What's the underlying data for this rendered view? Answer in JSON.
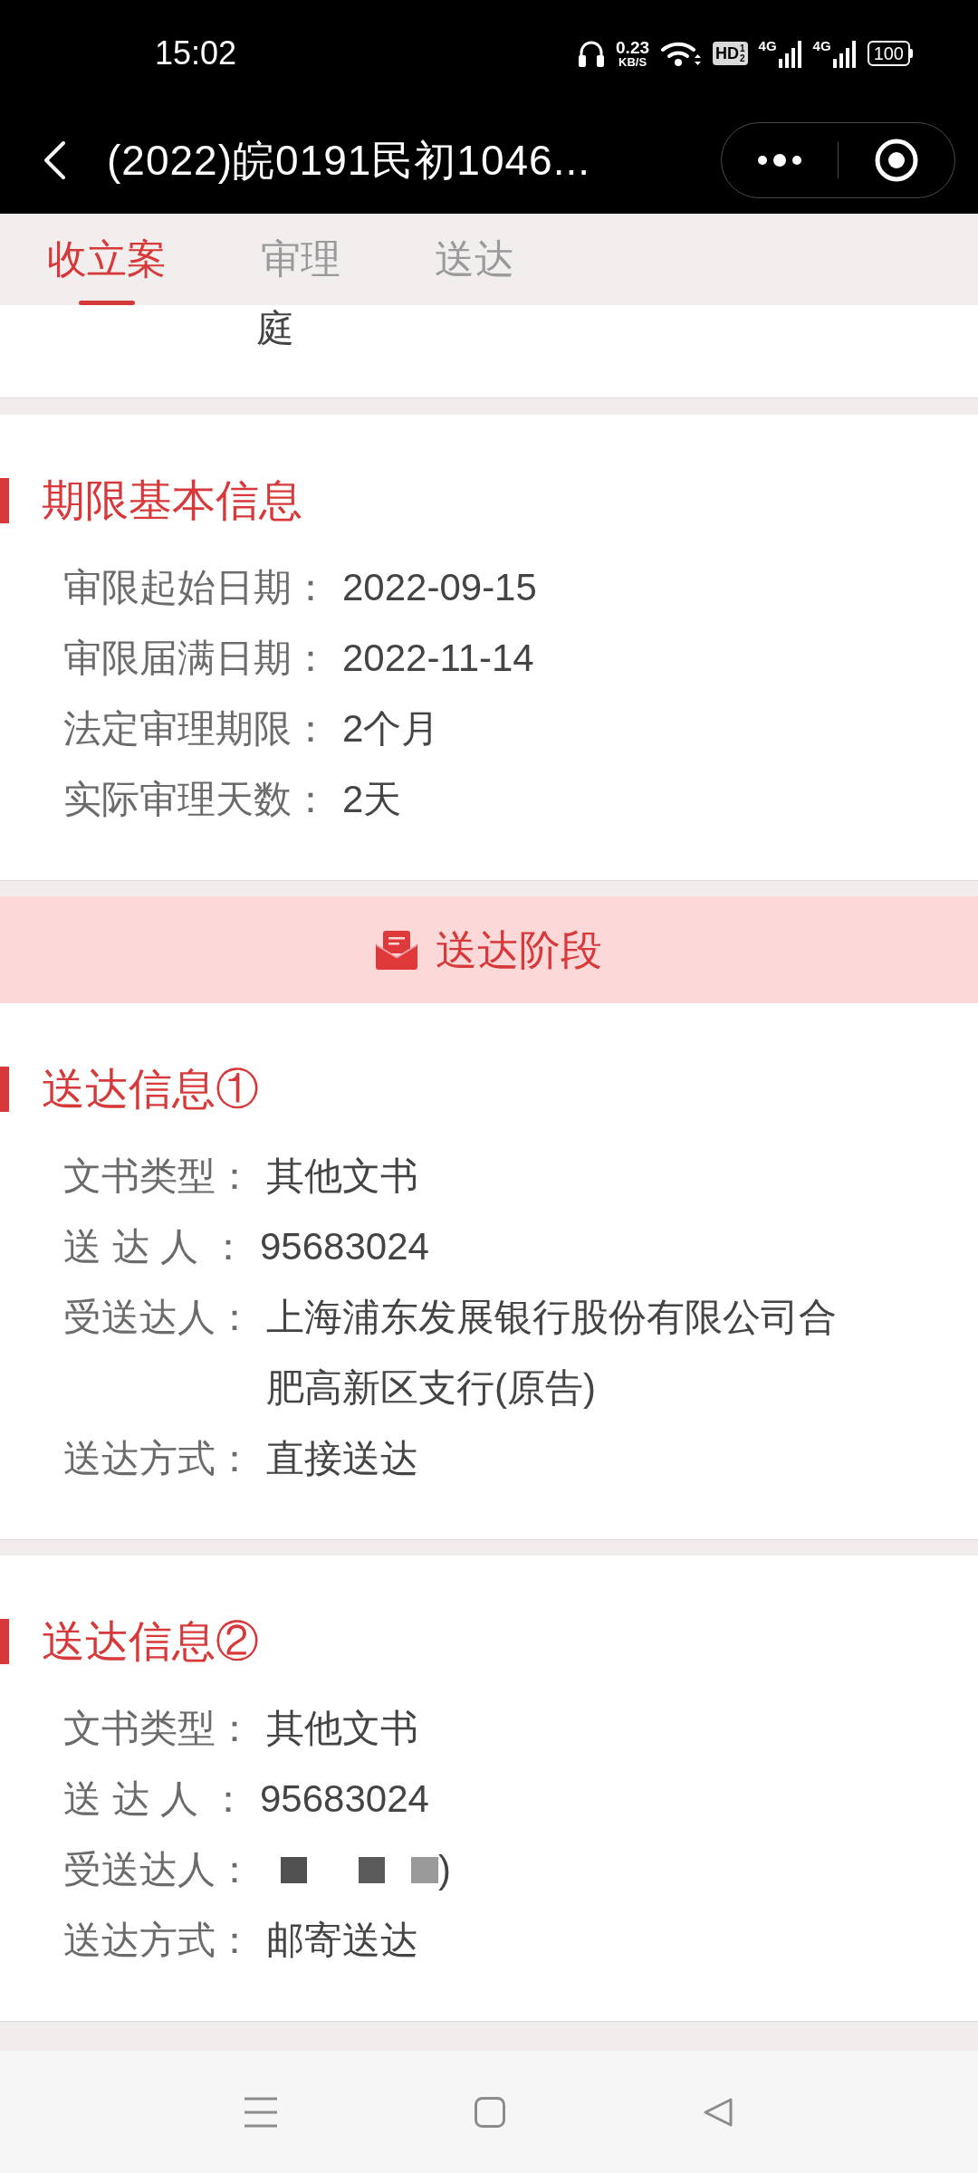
{
  "status_bar": {
    "time": "15:02",
    "net_speed": {
      "value": "0.23",
      "unit": "KB/S"
    },
    "hd_badge": {
      "label": "HD",
      "sup": "1",
      "sub": "2"
    },
    "signals": [
      {
        "network": "4G"
      },
      {
        "network": "4G"
      }
    ],
    "battery": "100"
  },
  "title_bar": {
    "title": "(2022)皖0191民初1046..."
  },
  "tabs": [
    {
      "label": "收立案",
      "selected": true
    },
    {
      "label": "审理",
      "selected": false
    },
    {
      "label": "送达",
      "selected": false
    }
  ],
  "previous_section": {
    "text": "庭"
  },
  "sections": [
    {
      "kind": "info",
      "title": "期限基本信息",
      "fields": [
        {
          "label": "审限起始日期：",
          "value": "2022-09-15",
          "redacted": false
        },
        {
          "label": "审限届满日期：",
          "value": "2022-11-14",
          "redacted": false
        },
        {
          "label": "法定审理期限：",
          "value": "2个月",
          "redacted": false
        },
        {
          "label": "实际审理天数：",
          "value": "2天",
          "redacted": false
        }
      ]
    },
    {
      "kind": "stage_banner",
      "title": "送达阶段"
    },
    {
      "kind": "info",
      "title": "送达信息①",
      "fields": [
        {
          "label": "文书类型：",
          "value": "其他文书",
          "redacted": false
        },
        {
          "label": "送 达 人 ：",
          "value": "95683024",
          "redacted": false
        },
        {
          "label": "受送达人：",
          "value": "上海浦东发展银行股份有限公司合肥高新区支行(原告)",
          "redacted": false
        },
        {
          "label": "送达方式：",
          "value": "直接送达",
          "redacted": false
        }
      ]
    },
    {
      "kind": "info",
      "title": "送达信息②",
      "fields": [
        {
          "label": "文书类型：",
          "value": "其他文书",
          "redacted": false
        },
        {
          "label": "送 达 人 ：",
          "value": "95683024",
          "redacted": false
        },
        {
          "label": "受送达人：",
          "value": ")",
          "redacted": true
        },
        {
          "label": "送达方式：",
          "value": "邮寄送达",
          "redacted": false
        }
      ]
    }
  ]
}
